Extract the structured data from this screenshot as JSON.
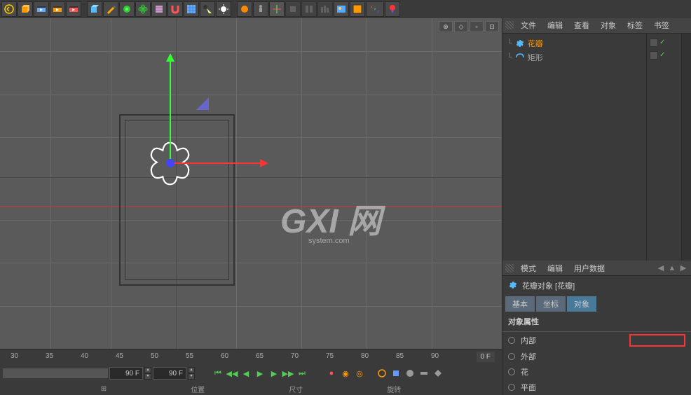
{
  "toolbar": {
    "icons": [
      "undo",
      "cube",
      "film",
      "film-fwd",
      "film-back",
      "cube-prim",
      "pen",
      "deformer",
      "atom",
      "cloth",
      "magnet",
      "floor",
      "light-spot",
      "light",
      "sun",
      "person",
      "axis",
      "snap1",
      "snap2",
      "snap3",
      "render-pic",
      "render-reg",
      "xyz",
      "record"
    ]
  },
  "viewport": {
    "widgets": [
      "⊕",
      "◇",
      "▫",
      "⊡"
    ]
  },
  "watermark": {
    "main": "GXI 网",
    "sub": "system.com"
  },
  "timeline": {
    "marks": [
      30,
      35,
      40,
      45,
      50,
      55,
      60,
      65,
      70,
      75,
      80,
      85,
      90
    ],
    "current_frame": "0 F",
    "frame_start": "90 F",
    "frame_end": "90 F",
    "labels": [
      "位置",
      "尺寸",
      "旋转"
    ]
  },
  "object_manager": {
    "menu": [
      "文件",
      "编辑",
      "查看",
      "对象",
      "标签",
      "书签"
    ],
    "items": [
      {
        "name": "花瓣",
        "type": "petal"
      },
      {
        "name": "矩形",
        "type": "rect"
      }
    ]
  },
  "attributes": {
    "menu": [
      "模式",
      "编辑",
      "用户数据"
    ],
    "title": "花瓣对象 [花瓣]",
    "tabs": [
      "基本",
      "坐标",
      "对象"
    ],
    "section": "对象属性",
    "props": [
      "内部",
      "外部",
      "花",
      "平面"
    ]
  }
}
